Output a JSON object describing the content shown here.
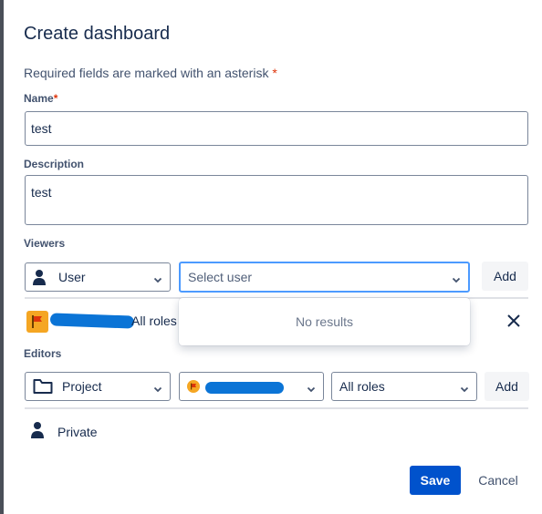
{
  "dialog": {
    "title": "Create dashboard",
    "required_note": "Required fields are marked with an asterisk",
    "required_star": "*"
  },
  "name_field": {
    "label": "Name",
    "required_star": "*",
    "value": "test"
  },
  "description_field": {
    "label": "Description",
    "value": "test"
  },
  "viewers": {
    "label": "Viewers",
    "type_select": {
      "value": "User",
      "icon": "person-icon"
    },
    "user_select": {
      "placeholder": "Select user",
      "dropdown_message": "No results"
    },
    "add_label": "Add",
    "entry": {
      "icon": "project-flag-icon",
      "roles": "All roles",
      "remove_icon": "close-icon",
      "name_redacted": true
    }
  },
  "editors": {
    "label": "Editors",
    "type_select": {
      "value": "Project",
      "icon": "folder-icon"
    },
    "project_select": {
      "icon": "project-flag-icon",
      "value_redacted": true
    },
    "roles_select": {
      "value": "All roles"
    },
    "add_label": "Add",
    "entry": {
      "icon": "person-icon",
      "label": "Private"
    }
  },
  "footer": {
    "save_label": "Save",
    "cancel_label": "Cancel"
  },
  "colors": {
    "primary": "#0052cc",
    "focus": "#4c9aff",
    "required": "#de350b",
    "redaction": "#0b74d6",
    "flag_orange": "#f5a623",
    "flag_red": "#de350b"
  }
}
